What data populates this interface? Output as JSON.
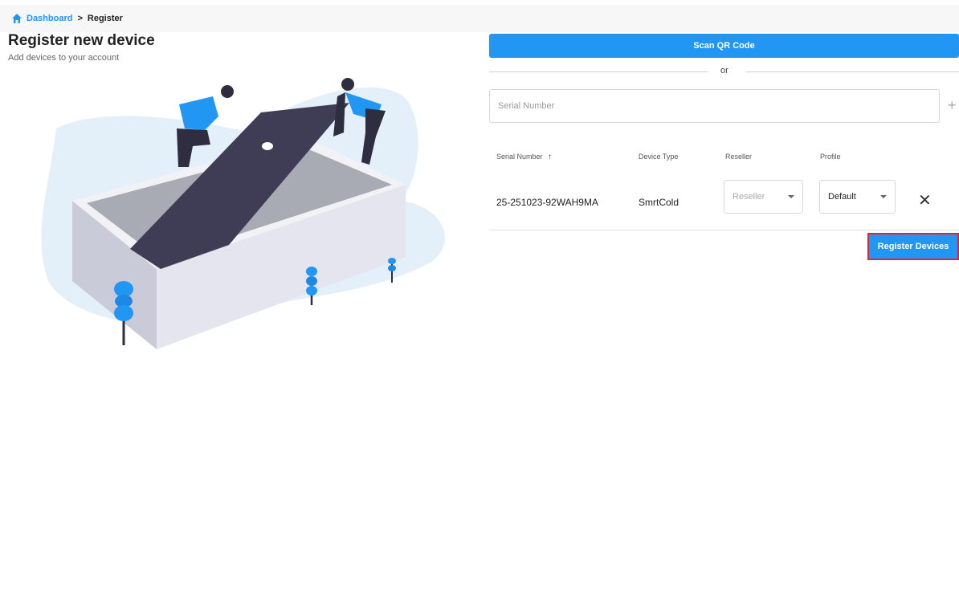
{
  "breadcrumb": {
    "home_icon": "home-icon",
    "items": [
      "Dashboard",
      "Register"
    ],
    "separator": ">"
  },
  "page": {
    "title": "Register new device",
    "subtitle": "Add devices to your account"
  },
  "scan": {
    "button_label": "Scan QR Code",
    "or_text": "or"
  },
  "serial_input": {
    "placeholder": "Serial Number",
    "value": "",
    "add_icon": "plus-icon"
  },
  "table": {
    "headers": [
      "Serial Number",
      "Device Type",
      "Reseller",
      "Profile"
    ],
    "sort_icon": "arrow-up-icon",
    "rows": [
      {
        "serial_number": "25-251023-92WAH9MA",
        "device_type": "SmrtCold",
        "reseller": "Reseller",
        "profile": "Default",
        "remove_icon": "close-icon"
      }
    ]
  },
  "actions": {
    "register_label": "Register Devices"
  },
  "colors": {
    "primary": "#2196F3",
    "highlight_border": "#e5252a"
  }
}
